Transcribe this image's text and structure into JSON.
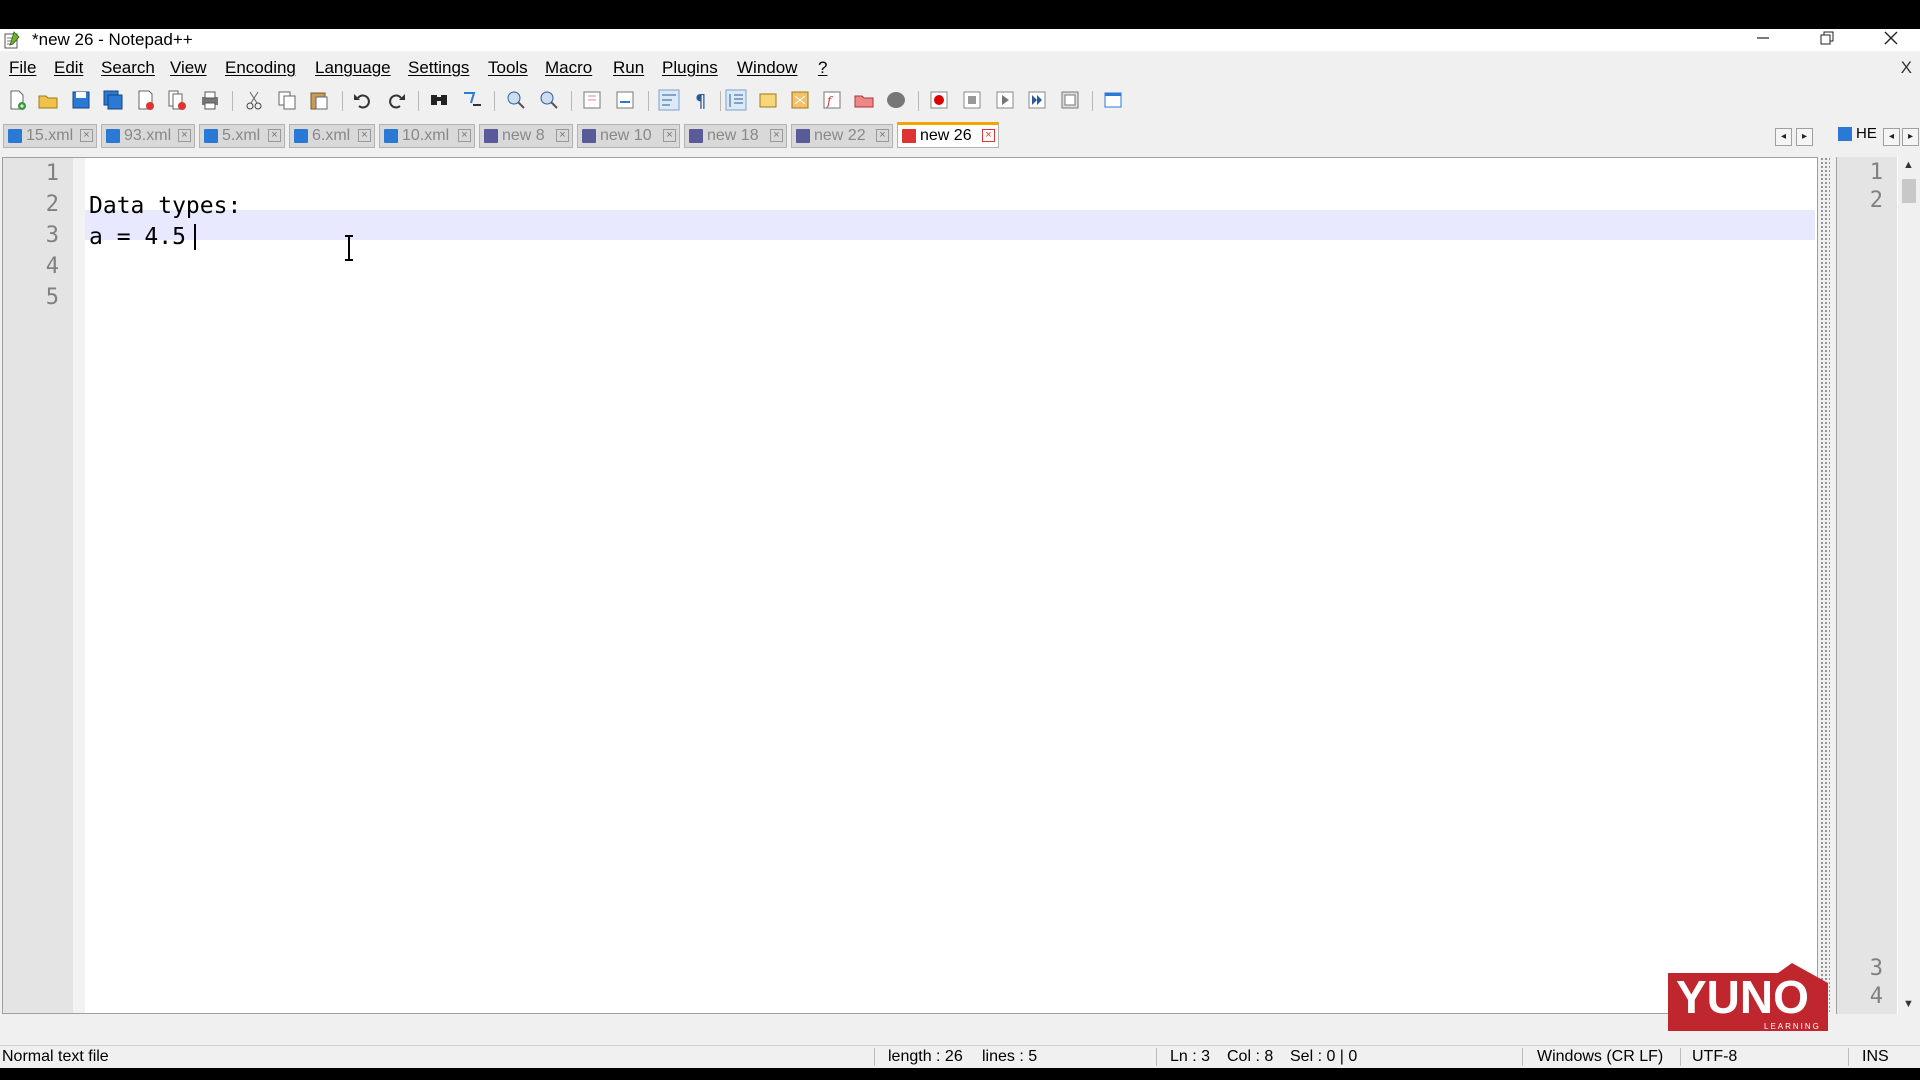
{
  "window": {
    "title": "*new 26 - Notepad++",
    "minimize_icon": "minimize-icon",
    "restore_icon": "restore-icon",
    "close_icon": "close-icon"
  },
  "menu": {
    "items": [
      "File",
      "Edit",
      "Search",
      "View",
      "Encoding",
      "Language",
      "Settings",
      "Tools",
      "Macro",
      "Run",
      "Plugins",
      "Window",
      "?"
    ],
    "close_doc": "X"
  },
  "tabs": [
    {
      "label": "15.xml",
      "saved": true
    },
    {
      "label": "93.xml",
      "saved": true
    },
    {
      "label": "5.xml",
      "saved": true
    },
    {
      "label": "6.xml",
      "saved": true
    },
    {
      "label": "10.xml",
      "saved": true
    },
    {
      "label": "new 8",
      "saved": true
    },
    {
      "label": "new 10",
      "saved": true
    },
    {
      "label": "new 18",
      "saved": true
    },
    {
      "label": "new 22",
      "saved": true
    },
    {
      "label": "new 26",
      "saved": false,
      "active": true
    }
  ],
  "editor": {
    "line_numbers": [
      "1",
      "2",
      "3",
      "4",
      "5"
    ],
    "lines": [
      "",
      "Data types:",
      "a = 4.5",
      "",
      ""
    ],
    "current_line": 3
  },
  "right_panel": {
    "tab_label": "HE",
    "line_numbers_top": [
      "1",
      "2"
    ],
    "line_numbers_bottom": [
      "3",
      "4"
    ]
  },
  "status": {
    "file_type": "Normal text file",
    "length": "length : 26",
    "lines": "lines : 5",
    "ln": "Ln : 3",
    "col": "Col : 8",
    "sel": "Sel : 0 | 0",
    "eol": "Windows (CR LF)",
    "encoding": "UTF-8",
    "mode": "INS"
  },
  "watermark": {
    "text": "YUNO",
    "subtext": "LEARNING"
  },
  "colors": {
    "active_tab_accent": "#f6a300",
    "current_line": "#e8e8ff",
    "saved_tab_icon": "#2a7ad5",
    "new_tab_icon": "#5a5a9a",
    "logo": "#c0262d"
  }
}
